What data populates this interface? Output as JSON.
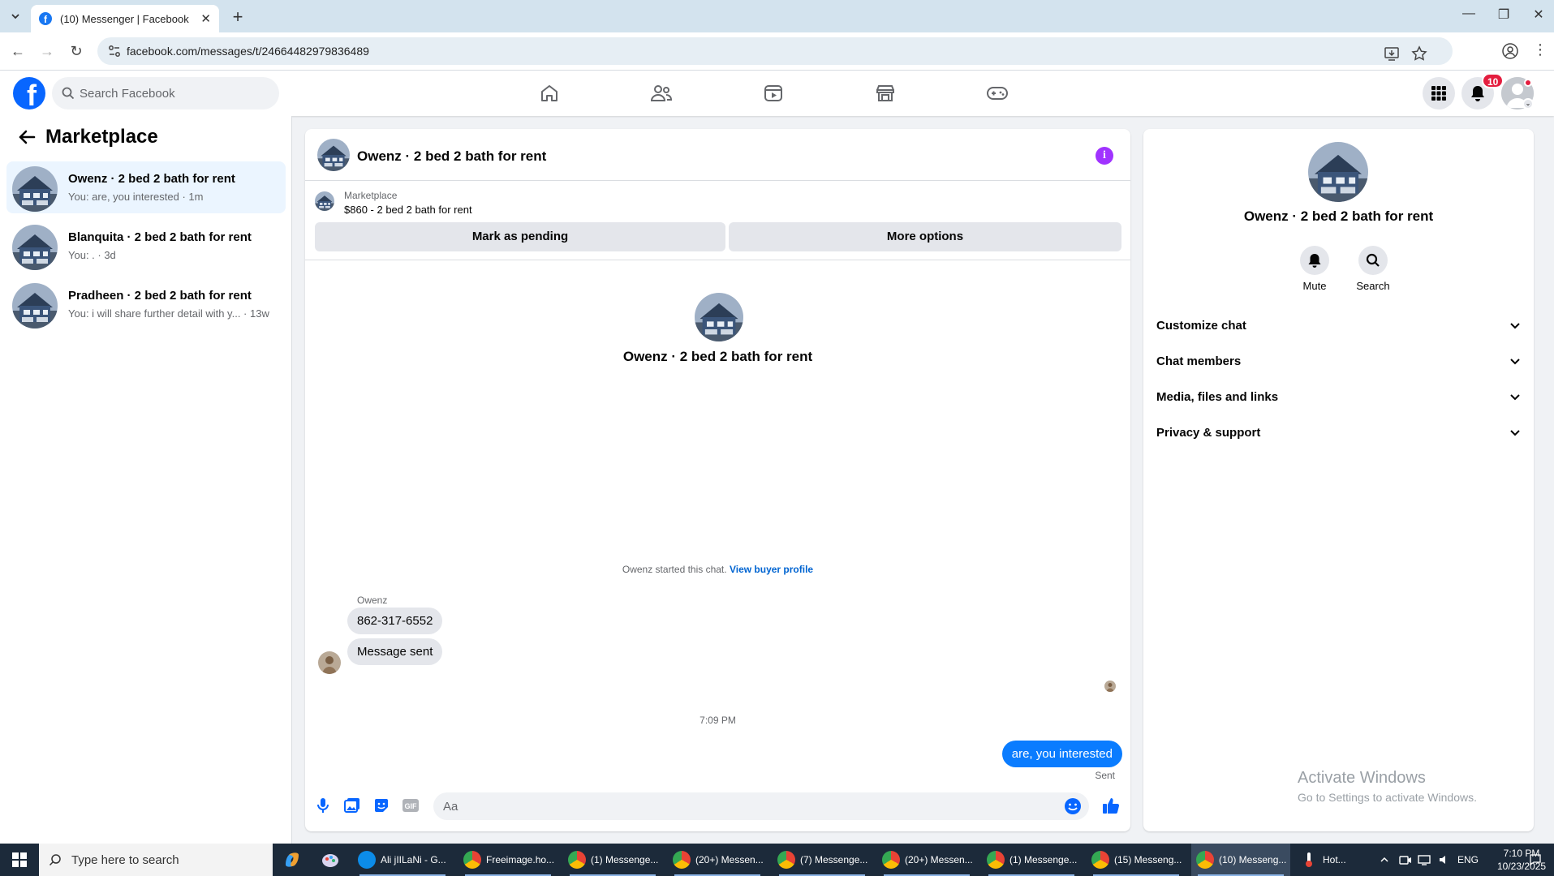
{
  "browser": {
    "tab_title": "(10) Messenger | Facebook",
    "url": "facebook.com/messages/t/24664482979836489"
  },
  "fb_header": {
    "search_placeholder": "Search Facebook",
    "notification_count": "10",
    "logo": "f"
  },
  "sidebar": {
    "title": "Marketplace",
    "conversations": [
      {
        "name": "Owenz · 2 bed 2 bath for rent",
        "preview": "You: are, you interested · 1m"
      },
      {
        "name": "Blanquita · 2 bed 2 bath for rent",
        "preview": "You: . · 3d"
      },
      {
        "name": "Pradheen · 2 bed 2 bath for rent",
        "preview": "You: i will share further detail with y... · 13w"
      }
    ]
  },
  "chat": {
    "title": "Owenz · 2 bed 2 bath for rent",
    "marketplace_label": "Marketplace",
    "listing": "$860 - 2 bed 2 bath for rent",
    "mark_pending": "Mark as pending",
    "more_options": "More options",
    "intro_name": "Owenz · 2 bed 2 bath for rent",
    "started_text": "Owenz started this chat.",
    "view_profile": "View buyer profile",
    "sender": "Owenz",
    "msg1": "862-317-6552",
    "msg2": "Message sent",
    "timestamp": "7:09 PM",
    "outgoing": "are, you interested",
    "status": "Sent",
    "composer_placeholder": "Aa"
  },
  "details": {
    "name": "Owenz · 2 bed 2 bath for rent",
    "mute": "Mute",
    "search": "Search",
    "sections": [
      "Customize chat",
      "Chat members",
      "Media, files and links",
      "Privacy & support"
    ]
  },
  "watermark": {
    "line1": "Activate Windows",
    "line2": "Go to Settings to activate Windows."
  },
  "taskbar": {
    "search_placeholder": "Type here to search",
    "apps": [
      {
        "label": "Ali jIILaNi - G...",
        "color": "#0c8ce9"
      },
      {
        "label": "Freeimage.ho...",
        "color": "#e84335"
      },
      {
        "label": "(1) Messenge...",
        "color": "#e84335"
      },
      {
        "label": "(20+) Messen...",
        "color": "#e84335"
      },
      {
        "label": "(7) Messenge...",
        "color": "#e84335"
      },
      {
        "label": "(20+) Messen...",
        "color": "#e84335"
      },
      {
        "label": "(1) Messenge...",
        "color": "#e84335"
      },
      {
        "label": "(15) Messeng...",
        "color": "#e84335"
      },
      {
        "label": "(10) Messeng...",
        "color": "#e84335"
      }
    ],
    "weather": "Hot...",
    "lang": "ENG",
    "time": "7:10 PM",
    "date": "10/23/2025"
  },
  "colors": {
    "accent": "#0866ff",
    "bubble_out": "#0a7cff",
    "info": "#a033ff",
    "badge": "#e41e3f"
  }
}
